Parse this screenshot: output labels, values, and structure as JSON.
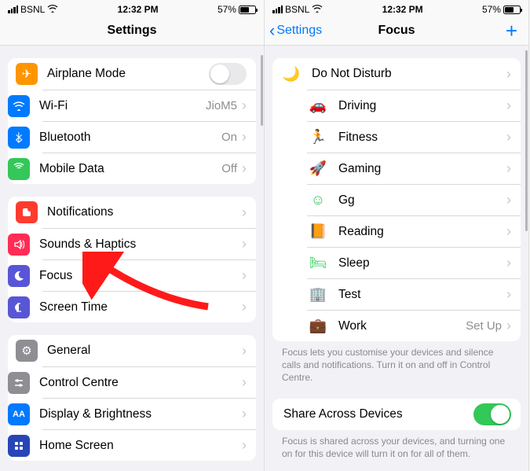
{
  "status": {
    "carrier": "BSNL",
    "time": "12:32 PM",
    "battery_pct": "57%"
  },
  "screen_left": {
    "title": "Settings",
    "g1": [
      {
        "icon": "airplane",
        "bg": "#ff9500",
        "label": "Airplane Mode",
        "toggle": "off"
      },
      {
        "icon": "wifi",
        "bg": "#007aff",
        "label": "Wi-Fi",
        "value": "JioM5"
      },
      {
        "icon": "bt",
        "bg": "#007aff",
        "label": "Bluetooth",
        "value": "On"
      },
      {
        "icon": "data",
        "bg": "#34c759",
        "label": "Mobile Data",
        "value": "Off"
      }
    ],
    "g2": [
      {
        "icon": "notif",
        "bg": "#ff3b30",
        "label": "Notifications"
      },
      {
        "icon": "sound",
        "bg": "#ff2d55",
        "label": "Sounds & Haptics"
      },
      {
        "icon": "focus",
        "bg": "#5856d6",
        "label": "Focus"
      },
      {
        "icon": "time",
        "bg": "#5856d6",
        "label": "Screen Time"
      }
    ],
    "g3": [
      {
        "icon": "gear",
        "bg": "#8e8e93",
        "label": "General"
      },
      {
        "icon": "control",
        "bg": "#8e8e93",
        "label": "Control Centre"
      },
      {
        "icon": "aa",
        "bg": "#007aff",
        "label": "Display & Brightness"
      },
      {
        "icon": "home",
        "bg": "#2845b8",
        "label": "Home Screen"
      }
    ]
  },
  "screen_right": {
    "back": "Settings",
    "title": "Focus",
    "items": [
      {
        "icon": "🌙",
        "color": "#5856d6",
        "label": "Do Not Disturb"
      },
      {
        "icon": "🚗",
        "color": "#5856d6",
        "label": "Driving"
      },
      {
        "icon": "🏃",
        "color": "#34c759",
        "label": "Fitness"
      },
      {
        "icon": "🚀",
        "color": "#0a84ff",
        "label": "Gaming"
      },
      {
        "icon": "☺",
        "color": "#34c759",
        "label": "Gg"
      },
      {
        "icon": "📙",
        "color": "#ff9500",
        "label": "Reading"
      },
      {
        "icon": "🛏",
        "color": "#30d158",
        "label": "Sleep"
      },
      {
        "icon": "🏢",
        "color": "#af52de",
        "label": "Test"
      },
      {
        "icon": "💼",
        "color": "#30b0c7",
        "label": "Work",
        "value": "Set Up"
      }
    ],
    "footer1": "Focus lets you customise your devices and silence calls and notifications. Turn it on and off in Control Centre.",
    "share_label": "Share Across Devices",
    "footer2": "Focus is shared across your devices, and turning one on for this device will turn it on for all of them."
  }
}
